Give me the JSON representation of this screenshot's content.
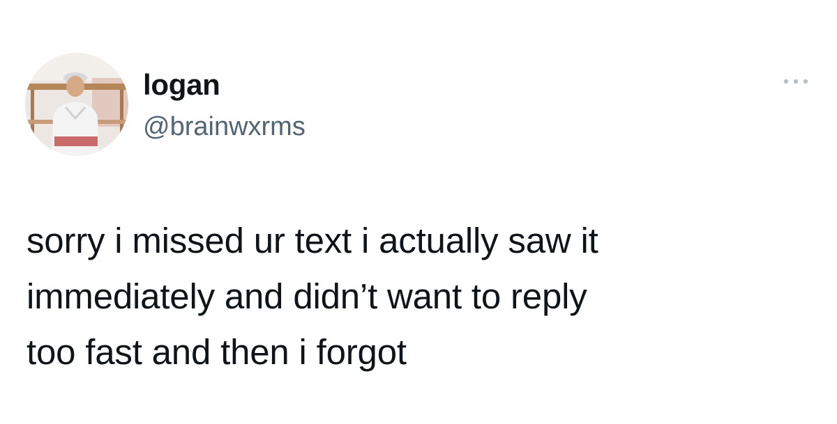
{
  "tweet": {
    "author": {
      "display_name": "logan",
      "handle": "@brainwxrms",
      "avatar_icon": "profile-photo"
    },
    "more_icon": "more-horizontal-icon",
    "text": "sorry i missed ur text i actually saw it\nimmediately and didn’t want to reply\ntoo fast and then i forgot"
  },
  "colors": {
    "background": "#ffffff",
    "primary_text": "#0f1419",
    "secondary_text": "#536471"
  }
}
